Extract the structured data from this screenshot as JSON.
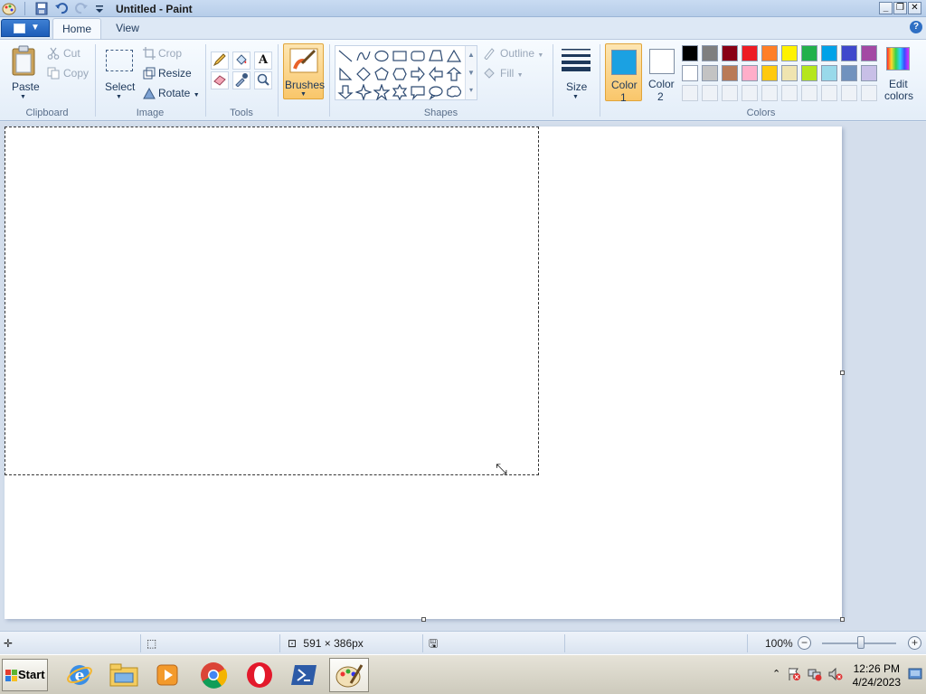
{
  "window": {
    "title": "Untitled - Paint",
    "controls": {
      "minimize": "_",
      "restore": "❐",
      "close": "✕"
    }
  },
  "tabs": [
    {
      "label": "Home",
      "active": true
    },
    {
      "label": "View",
      "active": false
    }
  ],
  "help_label": "?",
  "ribbon": {
    "clipboard": {
      "group_label": "Clipboard",
      "paste_label": "Paste",
      "cut_label": "Cut",
      "copy_label": "Copy"
    },
    "image": {
      "group_label": "Image",
      "select_label": "Select",
      "crop_label": "Crop",
      "resize_label": "Resize",
      "rotate_label": "Rotate"
    },
    "tools": {
      "group_label": "Tools",
      "items": [
        "pencil-icon",
        "fill-icon",
        "text-icon",
        "eraser-icon",
        "color-picker-icon",
        "magnifier-icon"
      ],
      "text_glyph": "A"
    },
    "brushes": {
      "label": "Brushes"
    },
    "shapes": {
      "group_label": "Shapes",
      "outline_label": "Outline",
      "fill_label": "Fill"
    },
    "size": {
      "label": "Size"
    },
    "colors": {
      "group_label": "Colors",
      "color1_label": "Color",
      "color1_num": "1",
      "color2_label": "Color",
      "color2_num": "2",
      "edit_label": "Edit",
      "edit_label2": "colors",
      "color1_value": "#1ba1e2",
      "color2_value": "#ffffff",
      "palette_row1": [
        "#000000",
        "#7f7f7f",
        "#880015",
        "#ed1c24",
        "#ff7f27",
        "#fff200",
        "#22b14c",
        "#00a2e8",
        "#3f48cc",
        "#a349a4"
      ],
      "palette_row2": [
        "#ffffff",
        "#c3c3c3",
        "#b97a57",
        "#ffaec9",
        "#ffc90e",
        "#efe4b0",
        "#b5e61d",
        "#99d9ea",
        "#7092be",
        "#c8bfe7"
      ]
    }
  },
  "statusbar": {
    "dimensions": "591 × 386px",
    "zoom": "100%",
    "zoom_minus": "−",
    "zoom_plus": "+"
  },
  "taskbar": {
    "start_label": "Start",
    "time": "12:26 PM",
    "date": "4/24/2023"
  }
}
